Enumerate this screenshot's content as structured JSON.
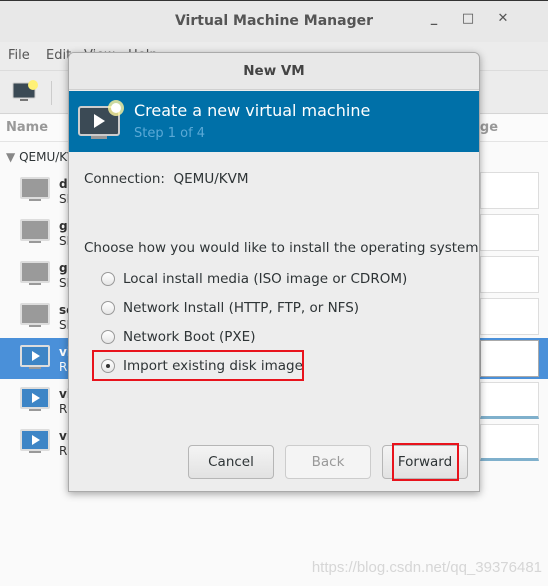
{
  "window": {
    "title": "Virtual Machine Manager",
    "minimize": "_",
    "maximize": "□",
    "close": "✕"
  },
  "menu": [
    "File",
    "Edit",
    "View",
    "Help"
  ],
  "list": {
    "header_name": "Name",
    "header_cpu": "CPU usage",
    "group": "QEMU/KVM",
    "rows": [
      {
        "name": "de",
        "state": "SI",
        "running": false
      },
      {
        "name": "ga",
        "state": "SI",
        "running": false
      },
      {
        "name": "ge",
        "state": "SI",
        "running": false
      },
      {
        "name": "se",
        "state": "SI",
        "running": false
      },
      {
        "name": "vi",
        "state": "R",
        "running": true,
        "selected": true
      },
      {
        "name": "vi",
        "state": "R",
        "running": true
      },
      {
        "name": "vi",
        "state": "R",
        "running": true
      }
    ]
  },
  "dialog": {
    "title": "New VM",
    "heading": "Create a new virtual machine",
    "step": "Step 1 of 4",
    "connection_label": "Connection:",
    "connection_value": "QEMU/KVM",
    "prompt": "Choose how you would like to install the operating system",
    "options": [
      {
        "label": "Local install media (ISO image or CDROM)",
        "selected": false
      },
      {
        "label": "Network Install (HTTP, FTP, or NFS)",
        "selected": false
      },
      {
        "label": "Network Boot (PXE)",
        "selected": false
      },
      {
        "label": "Import existing disk image",
        "selected": true
      }
    ],
    "buttons": {
      "cancel": "Cancel",
      "back": "Back",
      "forward": "Forward"
    }
  },
  "highlight_color": "#e8131c",
  "accent": "#0070a8",
  "watermark": "https://blog.csdn.net/qq_39376481"
}
